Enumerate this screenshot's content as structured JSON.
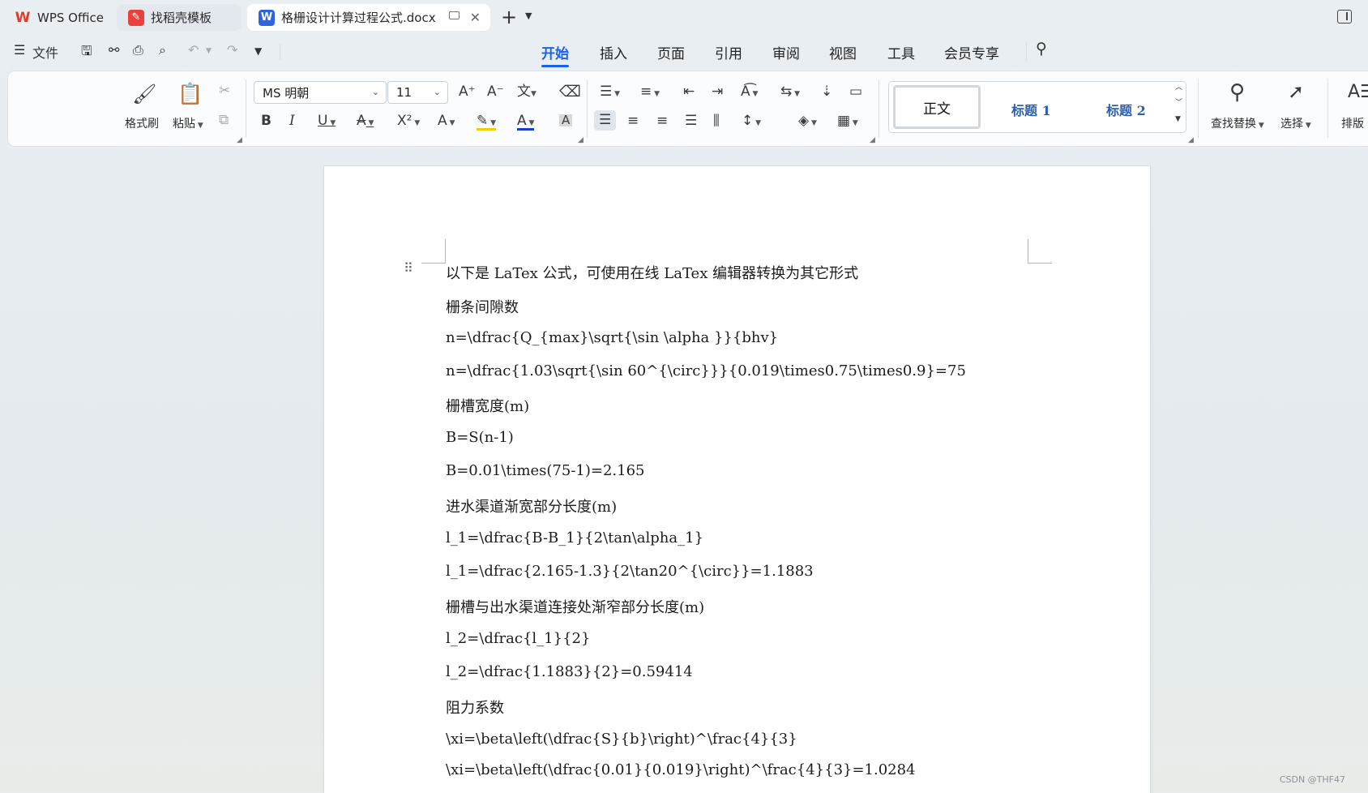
{
  "tabs": [
    {
      "label": "WPS Office",
      "logo": "W",
      "color": "#e23a2c"
    },
    {
      "label": "找稻壳模板",
      "logo": "❯",
      "color": "#e8403c"
    },
    {
      "label": "格栅设计计算过程公式.docx",
      "logo": "W",
      "color": "#2f64e0"
    }
  ],
  "quick": {
    "file_label": "文件"
  },
  "menus": [
    "开始",
    "插入",
    "页面",
    "引用",
    "审阅",
    "视图",
    "工具",
    "会员专享"
  ],
  "ribbon": {
    "format_painter": "格式刷",
    "paste": "粘贴",
    "font_name": "MS 明朝",
    "font_size": "11",
    "style_normal": "正文",
    "style_h1": "标题 1",
    "style_h2": "标题 2",
    "find_replace": "查找替换",
    "select": "选择",
    "layout": "排版"
  },
  "document": {
    "paragraphs": [
      "以下是 LaTex 公式，可使用在线 LaTex 编辑器转换为其它形式",
      "栅条间隙数",
      "n=\\dfrac{Q_{max}\\sqrt{\\sin \\alpha }}{bhv}",
      "n=\\dfrac{1.03\\sqrt{\\sin 60^{\\circ}}}{0.019\\times0.75\\times0.9}=75",
      "栅槽宽度(m)",
      "B=S(n-1)",
      "B=0.01\\times(75-1)=2.165",
      "进水渠道渐宽部分长度(m)",
      "l_1=\\dfrac{B-B_1}{2\\tan\\alpha_1}",
      "l_1=\\dfrac{2.165-1.3}{2\\tan20^{\\circ}}=1.1883",
      "栅槽与出水渠道连接处渐窄部分长度(m)",
      "l_2=\\dfrac{l_1}{2}",
      "l_2=\\dfrac{1.1883}{2}=0.59414",
      "阻力系数",
      "\\xi=\\beta\\left(\\dfrac{S}{b}\\right)^\\frac{4}{3}",
      "\\xi=\\beta\\left(\\dfrac{0.01}{0.019}\\right)^\\frac{4}{3}=1.0284"
    ]
  },
  "watermark": "CSDN @THF47",
  "colors": {
    "accent": "#1a62e8",
    "heading_style": "#2e5fa8"
  }
}
